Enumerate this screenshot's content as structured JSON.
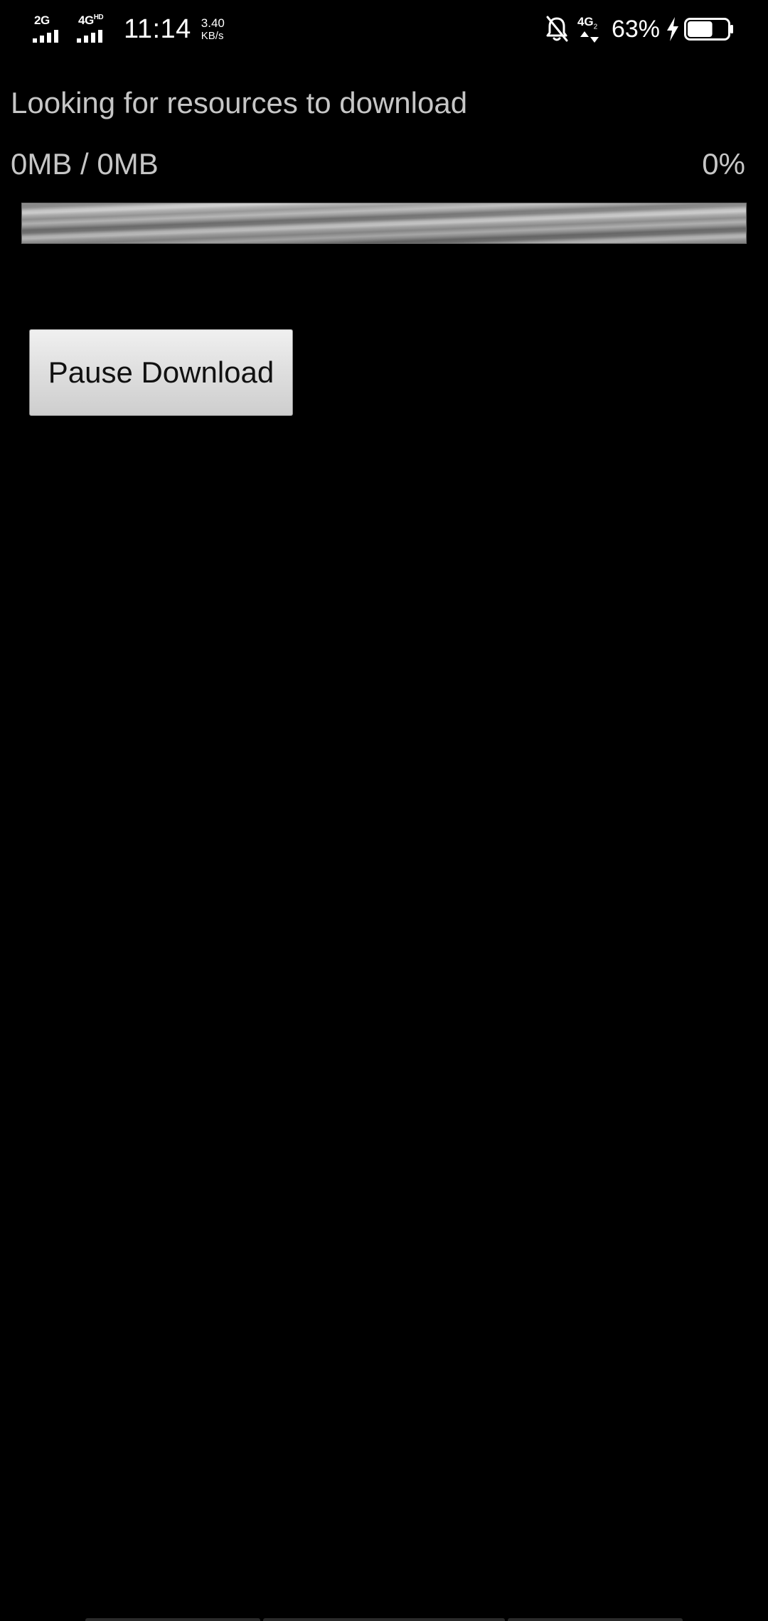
{
  "status_bar": {
    "sim1_type": "2G",
    "sim2_type": "4G",
    "sim2_hd": "HD",
    "time": "11:14",
    "speed_value": "3.40",
    "speed_unit": "KB/s",
    "data_type": "4G",
    "data_sub": "2",
    "battery_percent_text": "63%",
    "battery_level": 63,
    "icons": [
      "signal-2g-icon",
      "signal-4g-hd-icon",
      "bell-off-icon",
      "data-4g-arrows-icon",
      "charging-bolt-icon",
      "battery-icon"
    ]
  },
  "download": {
    "status_text": "Looking for resources to download",
    "size_text": "0MB / 0MB",
    "percent_text": "0%",
    "progress_percent": 0,
    "pause_label": "Pause Download"
  },
  "colors": {
    "background": "#000000",
    "secondary_text": "#c6c6c6",
    "button_text": "#111111"
  }
}
